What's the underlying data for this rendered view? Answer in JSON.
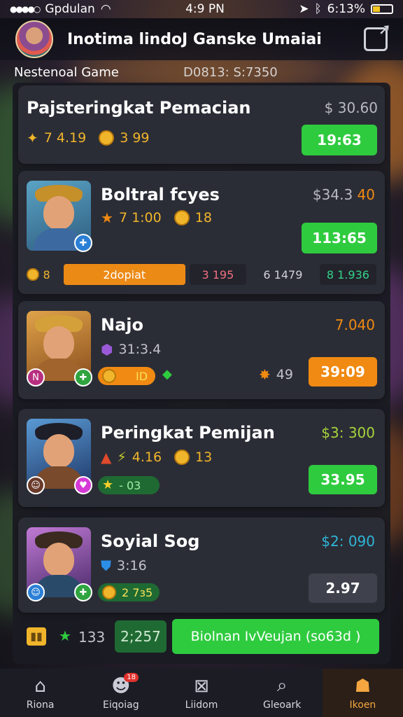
{
  "status": {
    "carrier": "Gpdulan",
    "time": "4:9 PN",
    "battery": "6:13%",
    "battery_level": 0.4
  },
  "header": {
    "title": "Inotima lindoJ Ganske Umaiai"
  },
  "subheader": {
    "left": "Nestenoal Game",
    "right": "D0813: S:7350"
  },
  "cards": [
    {
      "name": "Pajsteringkat Pemacian",
      "price": "$ 30.60",
      "stat1": "7 4.19",
      "stat2": "3 99",
      "button": "19:63"
    },
    {
      "name": "Boltral fcyes",
      "price_prefix": "$34.3",
      "price_suffix": "40",
      "stat1": "7 1:00",
      "stat2": "18",
      "button": "113:65",
      "row": {
        "count": "8",
        "progress_label": "2dopiat",
        "v1": "3 195",
        "v2": "6 1479",
        "v3": "8 1.936"
      }
    },
    {
      "name": "Najo",
      "price": "7.040",
      "stat1": "31:3.4",
      "bar_value": "ID",
      "stat_right": "49",
      "button": "39:09"
    },
    {
      "name": "Peringkat Pemijan",
      "price": "$3: 300",
      "stat1": "4.16",
      "stat2": "13",
      "bar_value": "- 03",
      "button": "33.95"
    },
    {
      "name": "Soyial Sog",
      "price": "$2: 090",
      "stat1": "3:16",
      "bar_value": "2 7ɜ5",
      "button": "2.97"
    }
  ],
  "bottom": {
    "value1": "133",
    "value2": "2;257",
    "cta": "Biolnan IvVeujan (so63d )"
  },
  "tabs": [
    {
      "label": "Riona",
      "icon": "home-icon"
    },
    {
      "label": "Eiqoiag",
      "icon": "chat-icon",
      "badge": "18"
    },
    {
      "label": "Liidom",
      "icon": "map-icon"
    },
    {
      "label": "Gleoark",
      "icon": "search-icon"
    },
    {
      "label": "Ikoen",
      "icon": "profile-icon"
    }
  ],
  "colors": {
    "green": "#2fcb3f",
    "orange": "#f08a12",
    "gold": "#f1b52b",
    "card": "#2b2d36"
  }
}
